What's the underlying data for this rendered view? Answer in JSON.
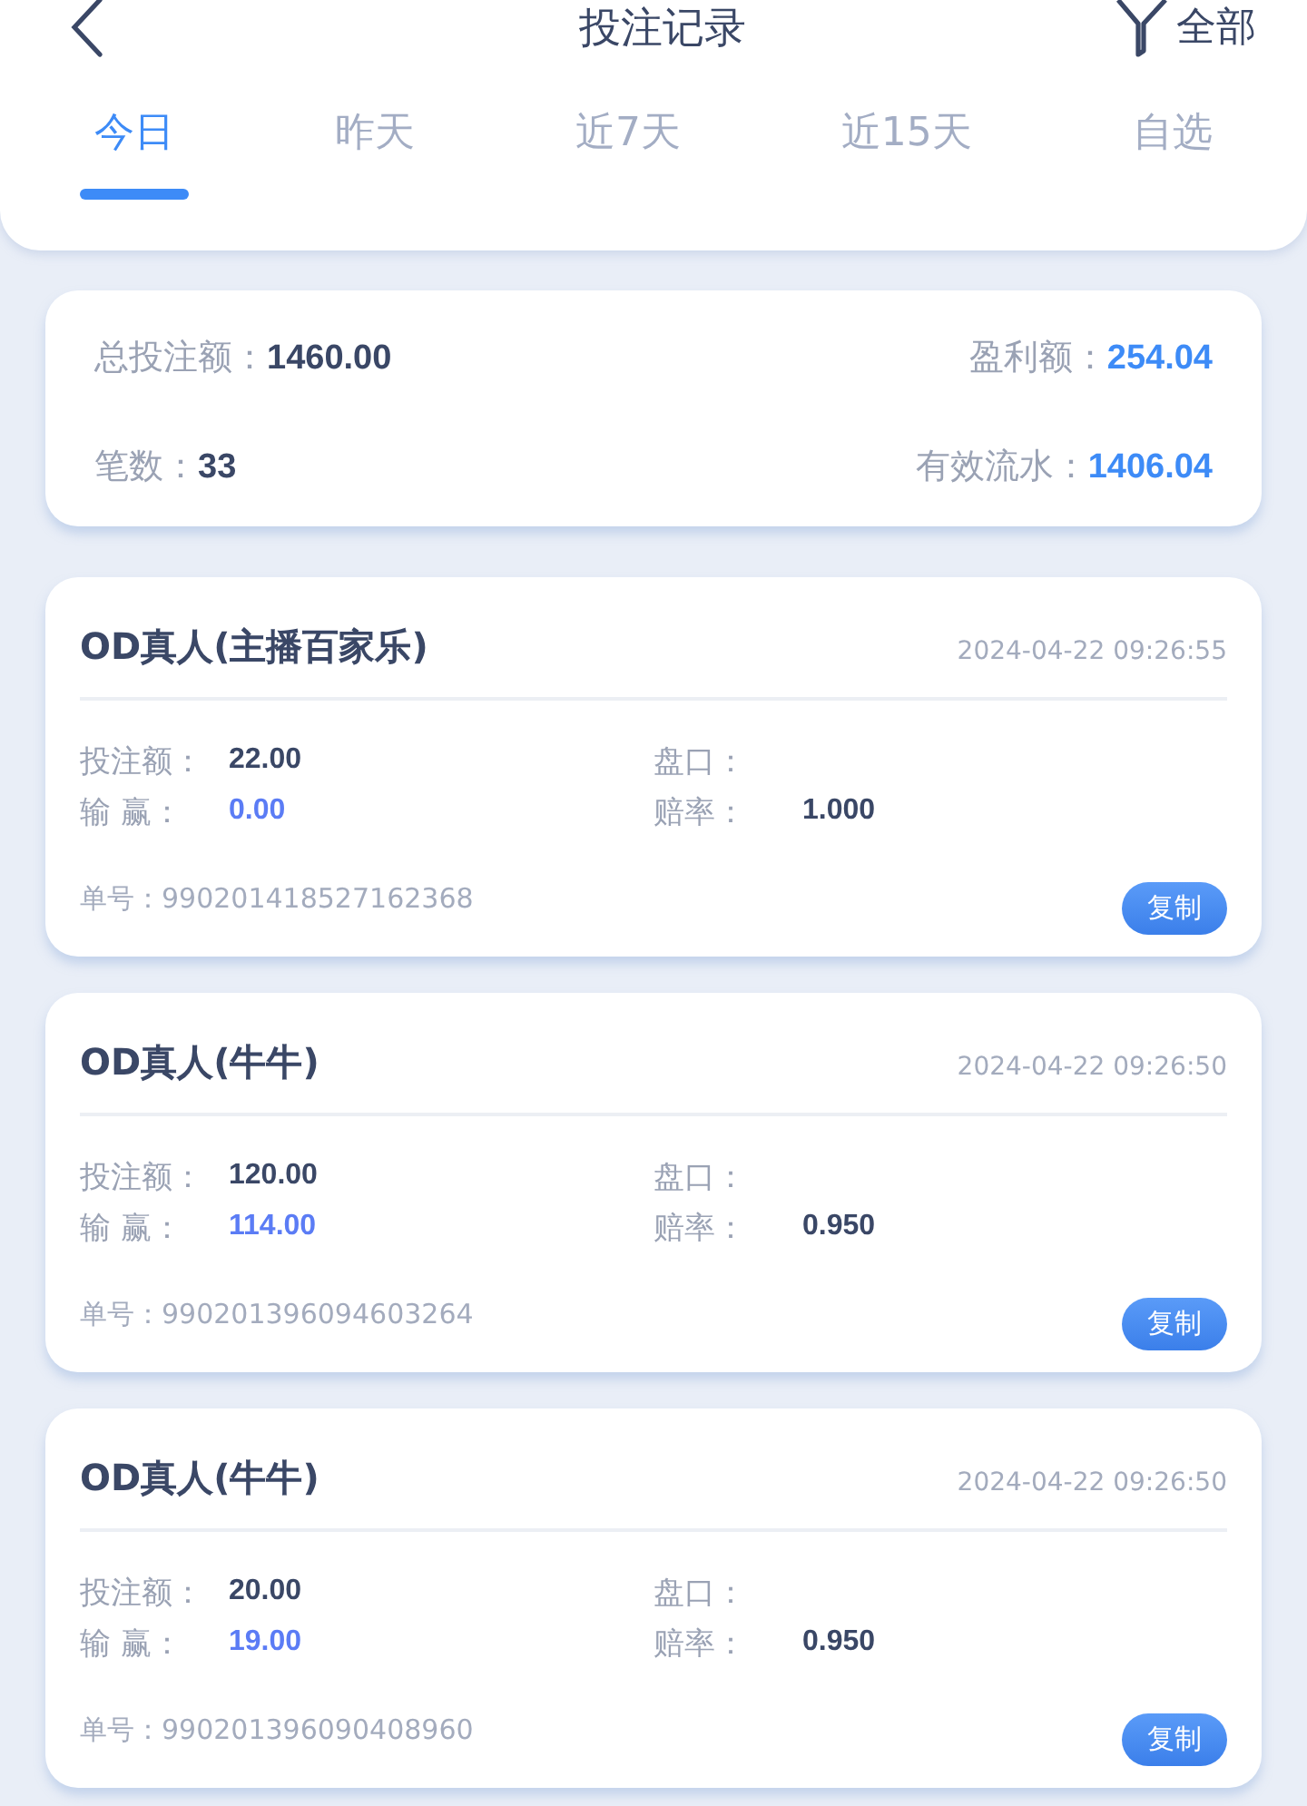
{
  "header": {
    "title": "投注记录",
    "filter_label": "全部"
  },
  "tabs": [
    {
      "label": "今日",
      "selected": true
    },
    {
      "label": "昨天",
      "selected": false
    },
    {
      "label": "近7天",
      "selected": false
    },
    {
      "label": "近15天",
      "selected": false
    },
    {
      "label": "自选",
      "selected": false
    }
  ],
  "summary": {
    "total_label": "总投注额：",
    "total": "1460.00",
    "profit_label": "盈利额：",
    "profit": "254.04",
    "count_label": "笔数：",
    "count": "33",
    "turnover_label": "有效流水：",
    "turnover": "1406.04"
  },
  "records": [
    {
      "game": "OD真人(主播百家乐)",
      "time": "2024-04-22 09:26:55",
      "stake_label": "投注额：",
      "stake": "22.00",
      "market_label": "盘口：",
      "win_label": "输 赢：",
      "win": "0.00",
      "odds_label": "赔率：",
      "odds": "1.000",
      "order_label": "单号：",
      "order": "990201418527162368",
      "copy": "复制"
    },
    {
      "game": "OD真人(牛牛)",
      "time": "2024-04-22 09:26:50",
      "stake_label": "投注额：",
      "stake": "120.00",
      "market_label": "盘口：",
      "win_label": "输 赢：",
      "win": "114.00",
      "odds_label": "赔率：",
      "odds": "0.950",
      "order_label": "单号：",
      "order": "990201396094603264",
      "copy": "复制"
    },
    {
      "game": "OD真人(牛牛)",
      "time": "2024-04-22 09:26:50",
      "stake_label": "投注额：",
      "stake": "20.00",
      "market_label": "盘口：",
      "win_label": "输 赢：",
      "win": "19.00",
      "odds_label": "赔率：",
      "odds": "0.950",
      "order_label": "单号：",
      "order": "990201396090408960",
      "copy": "复制"
    }
  ]
}
